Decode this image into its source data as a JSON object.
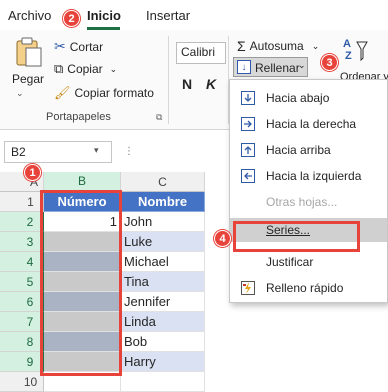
{
  "tabs": [
    {
      "label": "Archivo"
    },
    {
      "label": "Inicio"
    },
    {
      "label": "Insertar"
    }
  ],
  "badges": [
    "1",
    "2",
    "3",
    "4"
  ],
  "ribbon": {
    "paste_label": "Pegar",
    "cut_label": "Cortar",
    "copy_label": "Copiar",
    "format_painter_label": "Copiar formato",
    "clipboard_group": "Portapapeles",
    "font_name": "Calibri",
    "bold": "N",
    "italic": "K",
    "autosum_label": "Autosuma",
    "fill_label": "Rellenar",
    "sort_label": "Ordenar y"
  },
  "name_box": "B2",
  "columns": [
    "A",
    "B",
    "C"
  ],
  "rows": [
    "1",
    "2",
    "3",
    "4",
    "5",
    "6",
    "7",
    "8",
    "9",
    "10"
  ],
  "table": {
    "header_b": "Número",
    "header_c": "Nombre",
    "b_values": [
      "1",
      "",
      "",
      "",
      "",
      "",
      "",
      ""
    ],
    "names": [
      "John",
      "Luke",
      "Michael",
      "Tina",
      "Jennifer",
      "Linda",
      "Bob",
      "Harry"
    ]
  },
  "fill_menu": [
    {
      "label": "Hacia abajo",
      "icon": "fill-down-icon"
    },
    {
      "label": "Hacia la derecha",
      "icon": "fill-right-icon"
    },
    {
      "label": "Hacia arriba",
      "icon": "fill-up-icon"
    },
    {
      "label": "Hacia la izquierda",
      "icon": "fill-left-icon"
    },
    {
      "label": "Otras hojas...",
      "icon": ""
    },
    {
      "label": "Series...",
      "icon": ""
    },
    {
      "label": "Justificar",
      "icon": ""
    },
    {
      "label": "Relleno rápido",
      "icon": "flash-fill-icon"
    }
  ],
  "colors": {
    "accent": "#217346",
    "badge": "#e8433a",
    "table_header": "#4472c4",
    "band": "#d9e1f2"
  }
}
